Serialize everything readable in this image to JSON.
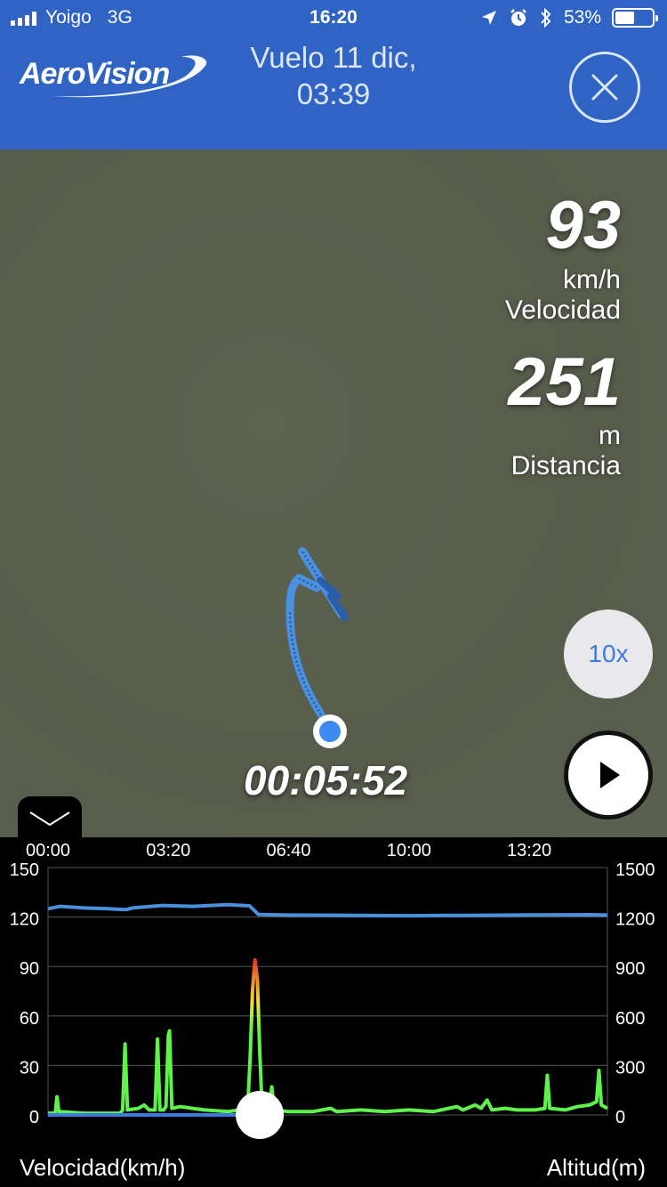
{
  "status_bar": {
    "carrier": "Yoigo",
    "network": "3G",
    "time": "16:20",
    "battery_percent": "53%",
    "battery_level": 0.53,
    "icons": [
      "signal-icon",
      "location-arrow-icon",
      "alarm-icon",
      "bluetooth-icon",
      "battery-icon"
    ]
  },
  "header": {
    "logo_text": "AeroVision",
    "title_line1": "Vuelo 11 dic,",
    "title_line2": "03:39",
    "close_icon": "close-icon",
    "background_color": "#2f63c4"
  },
  "map": {
    "speed_value": "93",
    "speed_unit": "km/h",
    "speed_label": "Velocidad",
    "distance_value": "251",
    "distance_unit": "m",
    "distance_label": "Distancia",
    "playback_speed": "10x",
    "elapsed_time": "00:05:52",
    "track_color": "#4a90e2"
  },
  "chart_data": {
    "type": "line",
    "x_tick_labels": [
      "00:00",
      "03:20",
      "06:40",
      "10:00",
      "13:20"
    ],
    "x_ticks_seconds": [
      0,
      200,
      400,
      600,
      800
    ],
    "x_range_seconds": [
      0,
      930
    ],
    "left_axis": {
      "label": "Velocidad(km/h)",
      "ticks": [
        0,
        30,
        60,
        90,
        120,
        150
      ],
      "range": [
        0,
        150
      ]
    },
    "right_axis": {
      "label": "Altitud(m)",
      "ticks": [
        0,
        300,
        600,
        900,
        1200,
        1500
      ],
      "range": [
        0,
        1500
      ]
    },
    "grid": true,
    "playhead_seconds": 352,
    "series": [
      {
        "name": "Velocidad(km/h)",
        "axis": "left",
        "color": "#5ef24a",
        "peak_color": "#e53b22",
        "points": [
          [
            0,
            1
          ],
          [
            12,
            1
          ],
          [
            15,
            11
          ],
          [
            18,
            2
          ],
          [
            60,
            1
          ],
          [
            120,
            1
          ],
          [
            124,
            3
          ],
          [
            128,
            43
          ],
          [
            132,
            3
          ],
          [
            150,
            4
          ],
          [
            160,
            6
          ],
          [
            168,
            3
          ],
          [
            178,
            3
          ],
          [
            182,
            46
          ],
          [
            186,
            3
          ],
          [
            192,
            3
          ],
          [
            196,
            5
          ],
          [
            200,
            48
          ],
          [
            202,
            51
          ],
          [
            206,
            4
          ],
          [
            220,
            5
          ],
          [
            240,
            4
          ],
          [
            260,
            3
          ],
          [
            300,
            2
          ],
          [
            332,
            4
          ],
          [
            336,
            35
          ],
          [
            340,
            76
          ],
          [
            344,
            94
          ],
          [
            348,
            82
          ],
          [
            352,
            38
          ],
          [
            356,
            3
          ],
          [
            368,
            4
          ],
          [
            372,
            17
          ],
          [
            376,
            3
          ],
          [
            400,
            2
          ],
          [
            440,
            2
          ],
          [
            470,
            4
          ],
          [
            480,
            2
          ],
          [
            520,
            3
          ],
          [
            560,
            2
          ],
          [
            600,
            3
          ],
          [
            640,
            2
          ],
          [
            680,
            5
          ],
          [
            690,
            3
          ],
          [
            710,
            6
          ],
          [
            720,
            4
          ],
          [
            730,
            9
          ],
          [
            738,
            3
          ],
          [
            760,
            4
          ],
          [
            780,
            3
          ],
          [
            810,
            3
          ],
          [
            826,
            4
          ],
          [
            830,
            24
          ],
          [
            834,
            4
          ],
          [
            860,
            3
          ],
          [
            880,
            5
          ],
          [
            900,
            6
          ],
          [
            912,
            8
          ],
          [
            916,
            27
          ],
          [
            920,
            6
          ],
          [
            930,
            4
          ]
        ]
      },
      {
        "name": "Altitud(m)",
        "axis": "right",
        "color": "#4a8fdc",
        "points": [
          [
            0,
            1250
          ],
          [
            20,
            1265
          ],
          [
            60,
            1255
          ],
          [
            100,
            1250
          ],
          [
            130,
            1245
          ],
          [
            140,
            1255
          ],
          [
            190,
            1270
          ],
          [
            240,
            1265
          ],
          [
            300,
            1275
          ],
          [
            335,
            1268
          ],
          [
            350,
            1215
          ],
          [
            400,
            1212
          ],
          [
            500,
            1210
          ],
          [
            600,
            1208
          ],
          [
            700,
            1210
          ],
          [
            800,
            1213
          ],
          [
            900,
            1214
          ],
          [
            930,
            1212
          ]
        ]
      }
    ]
  }
}
